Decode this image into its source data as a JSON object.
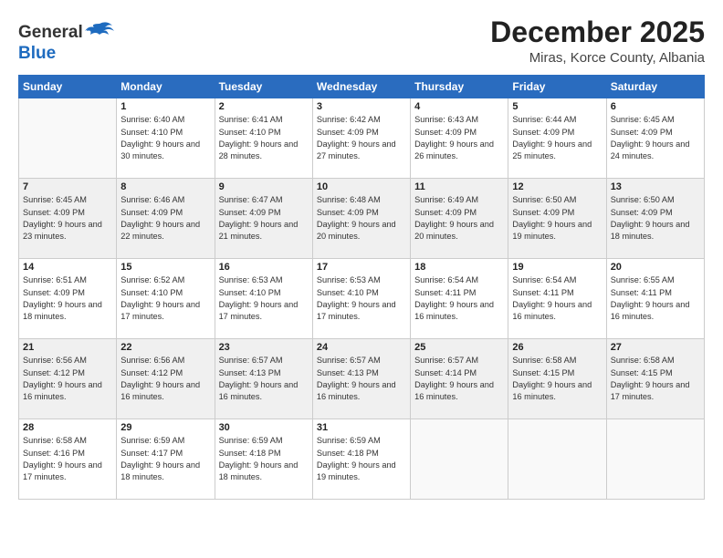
{
  "header": {
    "logo": {
      "line1": "General",
      "line2": "Blue"
    },
    "title": "December 2025",
    "subtitle": "Miras, Korce County, Albania"
  },
  "weekdays": [
    "Sunday",
    "Monday",
    "Tuesday",
    "Wednesday",
    "Thursday",
    "Friday",
    "Saturday"
  ],
  "weeks": [
    [
      {
        "day": "",
        "empty": true
      },
      {
        "day": "1",
        "sunrise": "6:40 AM",
        "sunset": "4:10 PM",
        "daylight": "9 hours and 30 minutes."
      },
      {
        "day": "2",
        "sunrise": "6:41 AM",
        "sunset": "4:10 PM",
        "daylight": "9 hours and 28 minutes."
      },
      {
        "day": "3",
        "sunrise": "6:42 AM",
        "sunset": "4:09 PM",
        "daylight": "9 hours and 27 minutes."
      },
      {
        "day": "4",
        "sunrise": "6:43 AM",
        "sunset": "4:09 PM",
        "daylight": "9 hours and 26 minutes."
      },
      {
        "day": "5",
        "sunrise": "6:44 AM",
        "sunset": "4:09 PM",
        "daylight": "9 hours and 25 minutes."
      },
      {
        "day": "6",
        "sunrise": "6:45 AM",
        "sunset": "4:09 PM",
        "daylight": "9 hours and 24 minutes."
      }
    ],
    [
      {
        "day": "7",
        "sunrise": "6:45 AM",
        "sunset": "4:09 PM",
        "daylight": "9 hours and 23 minutes."
      },
      {
        "day": "8",
        "sunrise": "6:46 AM",
        "sunset": "4:09 PM",
        "daylight": "9 hours and 22 minutes."
      },
      {
        "day": "9",
        "sunrise": "6:47 AM",
        "sunset": "4:09 PM",
        "daylight": "9 hours and 21 minutes."
      },
      {
        "day": "10",
        "sunrise": "6:48 AM",
        "sunset": "4:09 PM",
        "daylight": "9 hours and 20 minutes."
      },
      {
        "day": "11",
        "sunrise": "6:49 AM",
        "sunset": "4:09 PM",
        "daylight": "9 hours and 20 minutes."
      },
      {
        "day": "12",
        "sunrise": "6:50 AM",
        "sunset": "4:09 PM",
        "daylight": "9 hours and 19 minutes."
      },
      {
        "day": "13",
        "sunrise": "6:50 AM",
        "sunset": "4:09 PM",
        "daylight": "9 hours and 18 minutes."
      }
    ],
    [
      {
        "day": "14",
        "sunrise": "6:51 AM",
        "sunset": "4:09 PM",
        "daylight": "9 hours and 18 minutes."
      },
      {
        "day": "15",
        "sunrise": "6:52 AM",
        "sunset": "4:10 PM",
        "daylight": "9 hours and 17 minutes."
      },
      {
        "day": "16",
        "sunrise": "6:53 AM",
        "sunset": "4:10 PM",
        "daylight": "9 hours and 17 minutes."
      },
      {
        "day": "17",
        "sunrise": "6:53 AM",
        "sunset": "4:10 PM",
        "daylight": "9 hours and 17 minutes."
      },
      {
        "day": "18",
        "sunrise": "6:54 AM",
        "sunset": "4:11 PM",
        "daylight": "9 hours and 16 minutes."
      },
      {
        "day": "19",
        "sunrise": "6:54 AM",
        "sunset": "4:11 PM",
        "daylight": "9 hours and 16 minutes."
      },
      {
        "day": "20",
        "sunrise": "6:55 AM",
        "sunset": "4:11 PM",
        "daylight": "9 hours and 16 minutes."
      }
    ],
    [
      {
        "day": "21",
        "sunrise": "6:56 AM",
        "sunset": "4:12 PM",
        "daylight": "9 hours and 16 minutes."
      },
      {
        "day": "22",
        "sunrise": "6:56 AM",
        "sunset": "4:12 PM",
        "daylight": "9 hours and 16 minutes."
      },
      {
        "day": "23",
        "sunrise": "6:57 AM",
        "sunset": "4:13 PM",
        "daylight": "9 hours and 16 minutes."
      },
      {
        "day": "24",
        "sunrise": "6:57 AM",
        "sunset": "4:13 PM",
        "daylight": "9 hours and 16 minutes."
      },
      {
        "day": "25",
        "sunrise": "6:57 AM",
        "sunset": "4:14 PM",
        "daylight": "9 hours and 16 minutes."
      },
      {
        "day": "26",
        "sunrise": "6:58 AM",
        "sunset": "4:15 PM",
        "daylight": "9 hours and 16 minutes."
      },
      {
        "day": "27",
        "sunrise": "6:58 AM",
        "sunset": "4:15 PM",
        "daylight": "9 hours and 17 minutes."
      }
    ],
    [
      {
        "day": "28",
        "sunrise": "6:58 AM",
        "sunset": "4:16 PM",
        "daylight": "9 hours and 17 minutes."
      },
      {
        "day": "29",
        "sunrise": "6:59 AM",
        "sunset": "4:17 PM",
        "daylight": "9 hours and 18 minutes."
      },
      {
        "day": "30",
        "sunrise": "6:59 AM",
        "sunset": "4:18 PM",
        "daylight": "9 hours and 18 minutes."
      },
      {
        "day": "31",
        "sunrise": "6:59 AM",
        "sunset": "4:18 PM",
        "daylight": "9 hours and 19 minutes."
      },
      {
        "day": "",
        "empty": true
      },
      {
        "day": "",
        "empty": true
      },
      {
        "day": "",
        "empty": true
      }
    ]
  ],
  "labels": {
    "sunrise": "Sunrise:",
    "sunset": "Sunset:",
    "daylight": "Daylight:"
  }
}
